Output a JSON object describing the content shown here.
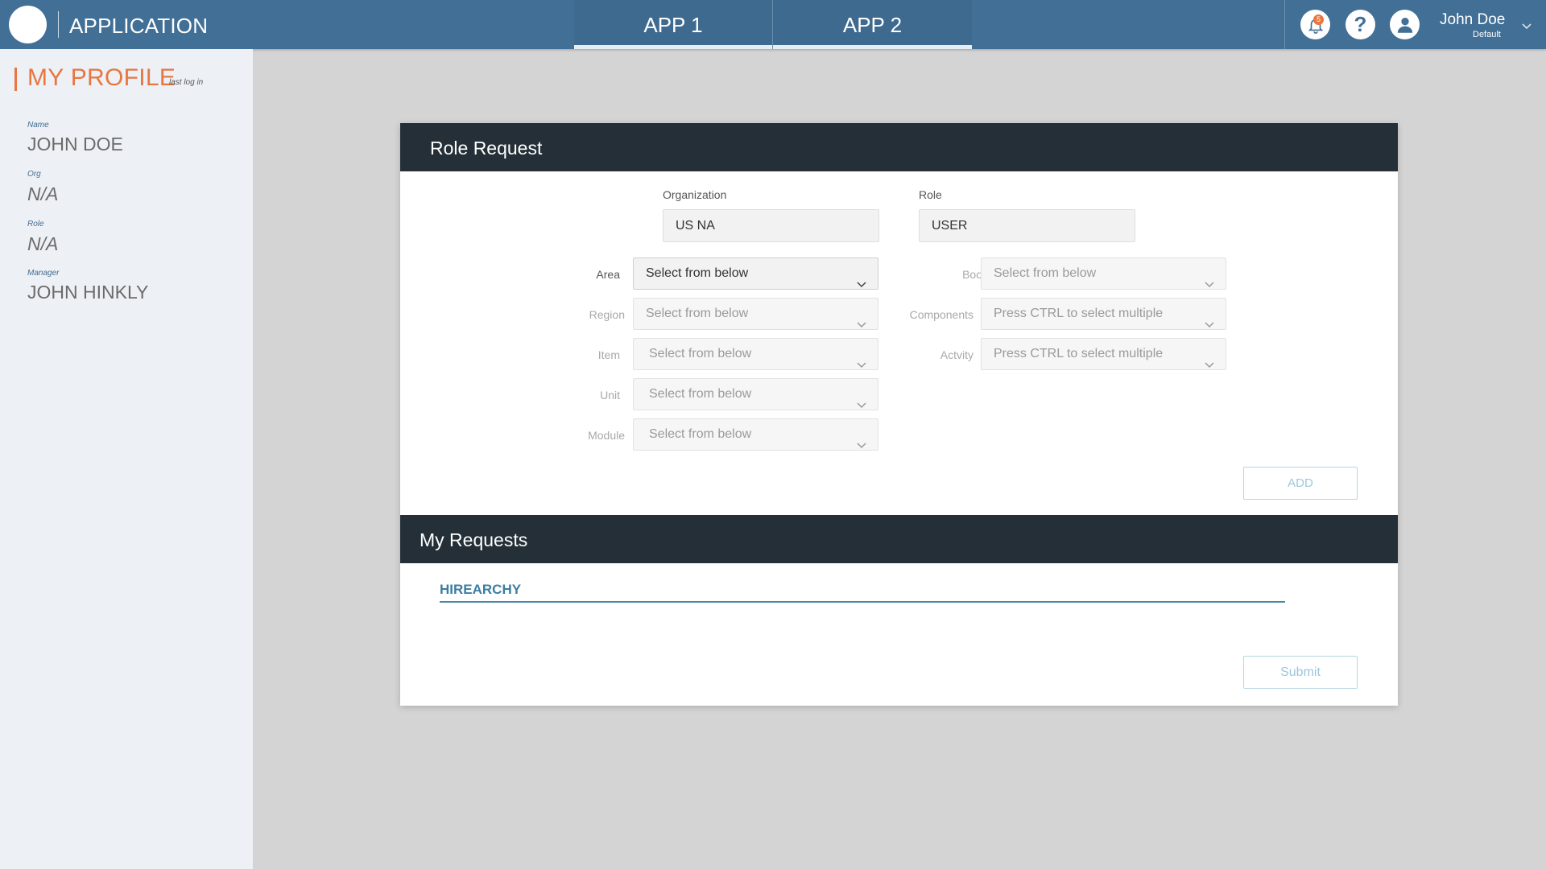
{
  "header": {
    "app_title": "APPLICATION",
    "tabs": [
      {
        "label": "APP 1"
      },
      {
        "label": "APP 2"
      }
    ],
    "notifications": {
      "count": "5",
      "icon": "bell-icon"
    },
    "help": {
      "icon": "help-icon",
      "glyph": "?"
    },
    "user": {
      "name": "John Doe",
      "role": "Default",
      "icon": "user-icon"
    }
  },
  "sidebar": {
    "title": "MY PROFILE",
    "last_log_in": "last log in",
    "fields": [
      {
        "label": "Name",
        "value": "JOHN DOE"
      },
      {
        "label": "Org",
        "value": "N/A"
      },
      {
        "label": "Role",
        "value": "N/A"
      },
      {
        "label": "Manager",
        "value": "JOHN HINKLY"
      }
    ]
  },
  "role_request": {
    "title": "Role Request",
    "organization": {
      "label": "Organization",
      "value": "US NA"
    },
    "role": {
      "label": "Role",
      "value": "USER"
    },
    "left_fields": [
      {
        "label": "Area",
        "value": "Select from below"
      },
      {
        "label": "Region",
        "value": "Select from below"
      },
      {
        "label": "Item",
        "value": "Select from below"
      },
      {
        "label": "Unit",
        "value": "Select from below"
      },
      {
        "label": "Module",
        "value": "Select from below"
      }
    ],
    "right_fields": [
      {
        "label": "Book",
        "value": "Select from below"
      },
      {
        "label": "Components",
        "value": "Press CTRL to select multiple"
      },
      {
        "label": "Actvity",
        "value": "Press CTRL to select multiple"
      }
    ],
    "add_label": "ADD"
  },
  "my_requests": {
    "title": "My Requests",
    "tab_label": "HIREARCHY",
    "submit_label": "Submit"
  },
  "colors": {
    "header_bg": "#426f96",
    "accent_orange": "#e8763f",
    "card_header_bg": "#242f37",
    "link_blue": "#3a7ea1"
  }
}
